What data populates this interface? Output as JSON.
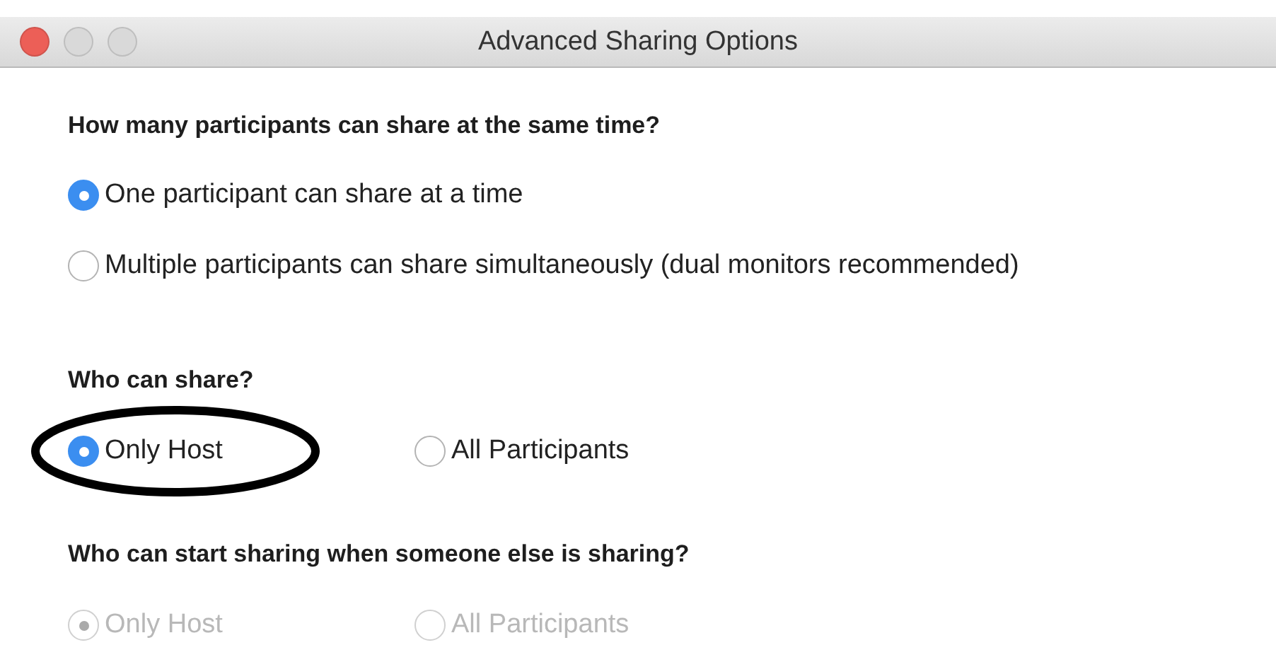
{
  "window": {
    "title": "Advanced Sharing Options",
    "controls": [
      {
        "kind": "close"
      },
      {
        "kind": "minimize"
      },
      {
        "kind": "zoom"
      }
    ]
  },
  "sections": [
    {
      "heading": "How many participants can share at the same time?",
      "kind": "stacked",
      "options": [
        {
          "label": "One participant can share at a time",
          "selected": true,
          "disabled": false,
          "circled": false
        },
        {
          "label": "Multiple participants can share simultaneously (dual monitors recommended)",
          "selected": false,
          "disabled": false,
          "circled": false
        }
      ]
    },
    {
      "heading": "Who can share?",
      "kind": "inline",
      "options": [
        {
          "label": "Only Host",
          "selected": true,
          "disabled": false,
          "circled": true
        },
        {
          "label": "All Participants",
          "selected": false,
          "disabled": false,
          "circled": false
        }
      ]
    },
    {
      "heading": "Who can start sharing when someone else is sharing?",
      "kind": "inline",
      "options": [
        {
          "label": "Only Host",
          "selected": true,
          "disabled": true,
          "circled": false
        },
        {
          "label": "All Participants",
          "selected": false,
          "disabled": true,
          "circled": false
        }
      ]
    }
  ]
}
